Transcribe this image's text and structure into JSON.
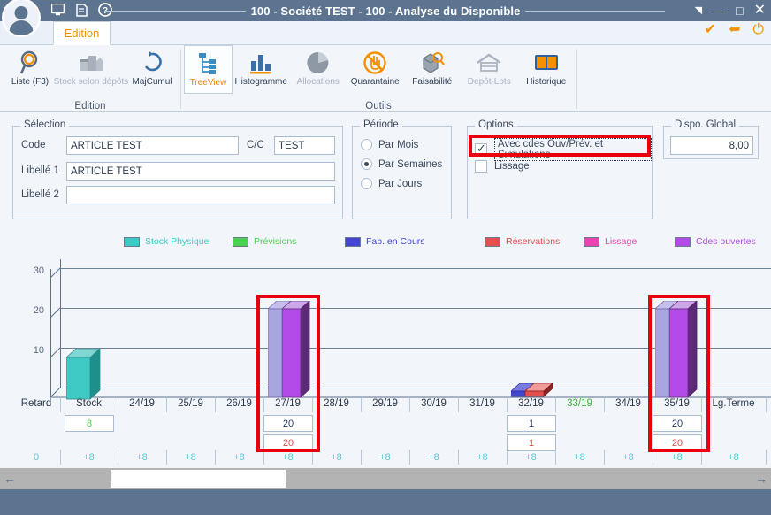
{
  "titlebar": {
    "title": "100 - Société TEST - 100 - Analyse du Disponible",
    "icons": [
      "monitor-icon",
      "note-icon",
      "help-icon"
    ],
    "controls": {
      "restore": "◥",
      "minimize": "—",
      "maximize": "□",
      "close": "✕"
    }
  },
  "tabstrip": {
    "active_tab": "Edition",
    "actions": {
      "validate": "✔",
      "undo": "➥",
      "power": "⏻"
    }
  },
  "ribbon": {
    "groups": [
      {
        "label": "Edition",
        "buttons": [
          {
            "label": "Liste (F3)",
            "icon": "magnifier-icon",
            "state": "enabled"
          },
          {
            "label": "Stock selon dépôts",
            "icon": "warehouse-boxes-icon",
            "state": "disabled"
          },
          {
            "label": "MajCumul",
            "icon": "refresh-icon",
            "state": "enabled"
          }
        ]
      },
      {
        "label": "Outils",
        "buttons": [
          {
            "label": "TreeView",
            "icon": "treeview-icon",
            "state": "selected"
          },
          {
            "label": "Histogramme",
            "icon": "bar-chart-icon",
            "state": "enabled"
          },
          {
            "label": "Allocations",
            "icon": "pie-chart-icon",
            "state": "disabled"
          },
          {
            "label": "Quarantaine",
            "icon": "no-hand-icon",
            "state": "enabled"
          },
          {
            "label": "Faisabilité",
            "icon": "box-search-icon",
            "state": "enabled"
          },
          {
            "label": "Depôt-Lots",
            "icon": "warehouse-icon",
            "state": "disabled"
          },
          {
            "label": "Historique",
            "icon": "book-icon",
            "state": "enabled"
          }
        ]
      }
    ]
  },
  "selection": {
    "title": "Sélection",
    "code_label": "Code",
    "code_value": "ARTICLE TEST",
    "cc_label": "C/C",
    "cc_value": "TEST",
    "libelle1_label": "Libellé 1",
    "libelle1_value": "ARTICLE TEST",
    "libelle2_label": "Libellé 2",
    "libelle2_value": ""
  },
  "periode": {
    "title": "Période",
    "options": [
      {
        "label": "Par Mois",
        "selected": false
      },
      {
        "label": "Par Semaines",
        "selected": true
      },
      {
        "label": "Par Jours",
        "selected": false
      }
    ]
  },
  "options": {
    "title": "Options",
    "items": [
      {
        "label": "Avec cdes Ouv/Prév. et Simulations",
        "checked": true,
        "focused": true
      },
      {
        "label": "Lissage",
        "checked": false,
        "focused": false
      }
    ]
  },
  "dispo_global": {
    "title": "Dispo. Global",
    "value": "8,00"
  },
  "chart_data": {
    "type": "bar",
    "title": "",
    "xlabel": "",
    "ylabel": "",
    "ylim": [
      0,
      33
    ],
    "yticks": [
      10,
      20,
      30
    ],
    "grid": true,
    "legend_position": "top",
    "categories": [
      "Retard",
      "Stock",
      "24/19",
      "25/19",
      "26/19",
      "27/19",
      "28/19",
      "29/19",
      "30/19",
      "31/19",
      "32/19",
      "33/19",
      "34/19",
      "35/19",
      "Lg.Terme"
    ],
    "current_period": "33/19",
    "series": [
      {
        "name": "Stock Physique",
        "color": "#3fc9c4",
        "values": [
          0,
          8,
          0,
          0,
          0,
          0,
          0,
          0,
          0,
          0,
          0,
          0,
          0,
          0,
          0
        ]
      },
      {
        "name": "Prévisions",
        "color": "#49d14f",
        "values": [
          0,
          0,
          0,
          0,
          0,
          0,
          0,
          0,
          0,
          0,
          0,
          0,
          0,
          0,
          0
        ]
      },
      {
        "name": "Fab. en Cours",
        "color": "#4346cf",
        "values": [
          0,
          0,
          0,
          0,
          0,
          0,
          0,
          0,
          0,
          0,
          1,
          0,
          0,
          0,
          0
        ]
      },
      {
        "name": "Réservations",
        "color": "#e2504f",
        "values": [
          0,
          0,
          0,
          0,
          0,
          0,
          0,
          0,
          0,
          0,
          1,
          0,
          0,
          0,
          0
        ]
      },
      {
        "name": "Lissage",
        "color": "#e845b0",
        "values": [
          0,
          0,
          0,
          0,
          0,
          0,
          0,
          0,
          0,
          0,
          0,
          0,
          0,
          0,
          0
        ]
      },
      {
        "name": "Cdes ouvertes",
        "color": "#b14ae6",
        "values": [
          0,
          0,
          0,
          0,
          0,
          20,
          0,
          0,
          0,
          0,
          0,
          0,
          0,
          20,
          0
        ]
      },
      {
        "name": "Simulations",
        "color": "#a9a5e0",
        "values": [
          0,
          0,
          0,
          0,
          0,
          20,
          0,
          0,
          0,
          0,
          0,
          0,
          0,
          20,
          0
        ]
      }
    ]
  },
  "legend": [
    {
      "label": "Stock Physique",
      "color": "#3fc9c4"
    },
    {
      "label": "Prévisions",
      "color": "#49d14f"
    },
    {
      "label": "Fab. en Cours",
      "color": "#4346cf"
    },
    {
      "label": "Réservations",
      "color": "#e2504f"
    },
    {
      "label": "Lissage",
      "color": "#e845b0"
    },
    {
      "label": "Cdes ouvertes",
      "color": "#b14ae6"
    }
  ],
  "grid_table": {
    "headers": [
      "Retard",
      "Stock",
      "24/19",
      "25/19",
      "26/19",
      "27/19",
      "28/19",
      "29/19",
      "30/19",
      "31/19",
      "32/19",
      "33/19",
      "34/19",
      "35/19",
      "Lg.Terme"
    ],
    "row_blue": [
      "",
      "8",
      "",
      "",
      "",
      "20",
      "",
      "",
      "",
      "",
      "1",
      "",
      "",
      "20",
      ""
    ],
    "row_red": [
      "",
      "",
      "",
      "",
      "",
      "20",
      "",
      "",
      "",
      "",
      "1",
      "",
      "",
      "20",
      ""
    ],
    "row_cumul": [
      "0",
      "+8",
      "+8",
      "+8",
      "+8",
      "+8",
      "+8",
      "+8",
      "+8",
      "+8",
      "+8",
      "+8",
      "+8",
      "+8",
      "+8"
    ]
  },
  "colors": {
    "titlebar": "#5c748f",
    "accent_orange": "#f59000",
    "highlight_red": "#e8000d",
    "cumul_cyan": "#5bc6d4",
    "current_green": "#3cb03c"
  },
  "scrollbar": {
    "left_arrow": "←",
    "right_arrow": "→"
  }
}
